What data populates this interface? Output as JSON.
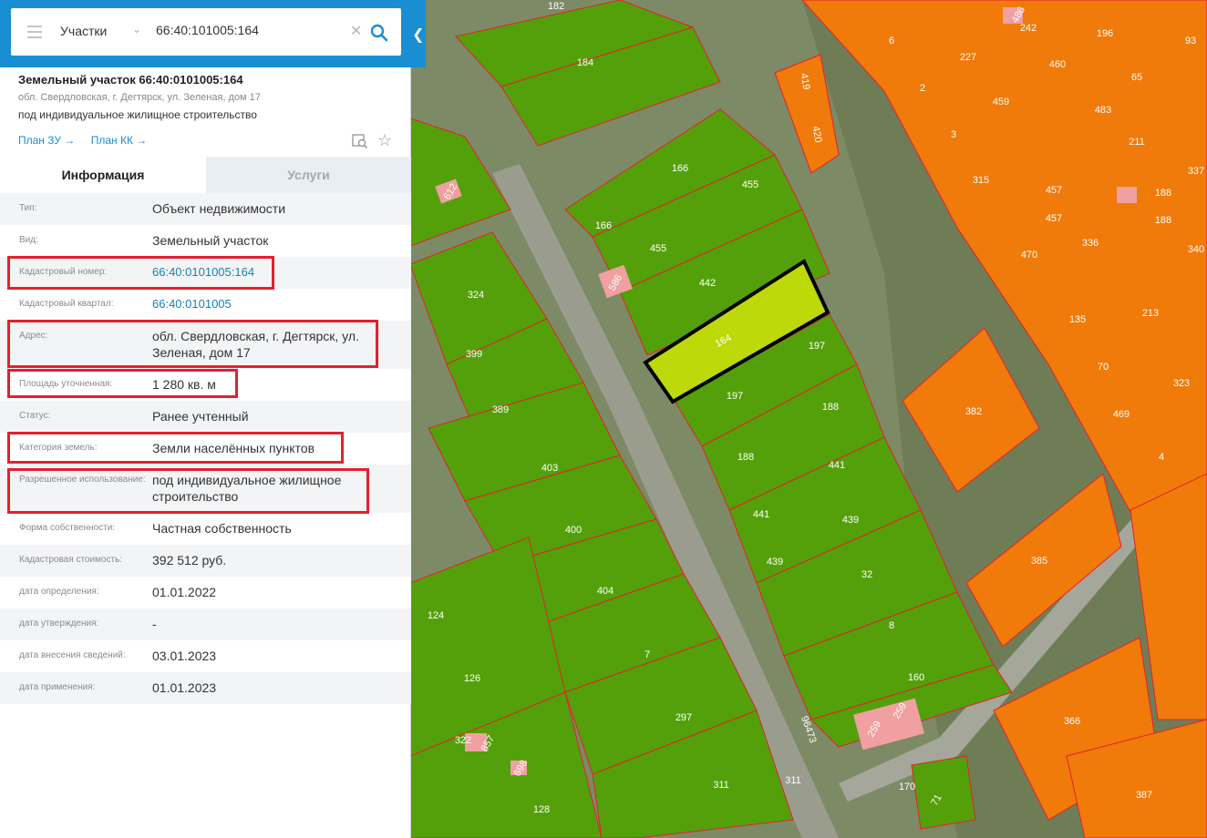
{
  "search": {
    "category": "Участки",
    "value": "66:40:101005:164"
  },
  "plot": {
    "title": "Земельный участок 66:40:0101005:164",
    "address": "обл. Свердловская, г. Дегтярск, ул. Зеленая, дом 17",
    "use": "под индивидуальное жилищное строительство",
    "plan_zu": "План ЗУ →",
    "plan_kk": "План КК →"
  },
  "tabs": {
    "info": "Информация",
    "services": "Услуги"
  },
  "rows": [
    {
      "label": "Тип:",
      "value": "Объект недвижимости"
    },
    {
      "label": "Вид:",
      "value": "Земельный участок"
    },
    {
      "label": "Кадастровый номер:",
      "value": "66:40:0101005:164"
    },
    {
      "label": "Кадастровый квартал:",
      "value": "66:40:0101005"
    },
    {
      "label": "Адрес:",
      "value": "обл. Свердловская, г. Дегтярск, ул. Зеленая, дом 17"
    },
    {
      "label": "Площадь уточненная:",
      "value": "1 280 кв. м"
    },
    {
      "label": "Статус:",
      "value": "Ранее учтенный"
    },
    {
      "label": "Категория земель:",
      "value": "Земли населённых пунктов"
    },
    {
      "label": "Разрешенное использование:",
      "value": "под индивидуальное жилищное строительство"
    },
    {
      "label": "Форма собственности:",
      "value": "Частная собственность"
    },
    {
      "label": "Кадастровая стоимость:",
      "value": "392 512 руб."
    },
    {
      "label": "дата определения:",
      "value": "01.01.2022"
    },
    {
      "label": "дата утверждения:",
      "value": "-"
    },
    {
      "label": "дата внесения сведений:",
      "value": "03.01.2023"
    },
    {
      "label": "дата применения:",
      "value": "01.01.2023"
    }
  ],
  "map": {
    "green_labels": [
      "182",
      "184",
      "166",
      "455",
      "166",
      "455",
      "442",
      "197",
      "197",
      "188",
      "188",
      "441",
      "441",
      "439",
      "439",
      "32",
      "8",
      "160",
      "324",
      "399",
      "389",
      "403",
      "400",
      "404",
      "7",
      "124",
      "126",
      "297",
      "311",
      "322",
      "128",
      "311",
      "170"
    ],
    "selected_label": "164",
    "orange_labels": [
      "6",
      "242",
      "196",
      "93",
      "227",
      "460",
      "65",
      "2",
      "459",
      "483",
      "3",
      "211",
      "315",
      "457",
      "188",
      "337",
      "457",
      "188",
      "470",
      "336",
      "340",
      "135",
      "213",
      "70",
      "323",
      "469",
      "4",
      "382",
      "385",
      "366",
      "387",
      "419",
      "420"
    ],
    "pink_labels": [
      "612",
      "586",
      "857",
      "698",
      "259",
      "259",
      "486",
      "71"
    ],
    "road_labels": [
      "96473"
    ],
    "colors": {
      "green": "#54a00a",
      "orange": "#f07a0a",
      "selected": "#bfd80a",
      "highlight": "#e4202e",
      "accent": "#1a8ed3"
    }
  }
}
